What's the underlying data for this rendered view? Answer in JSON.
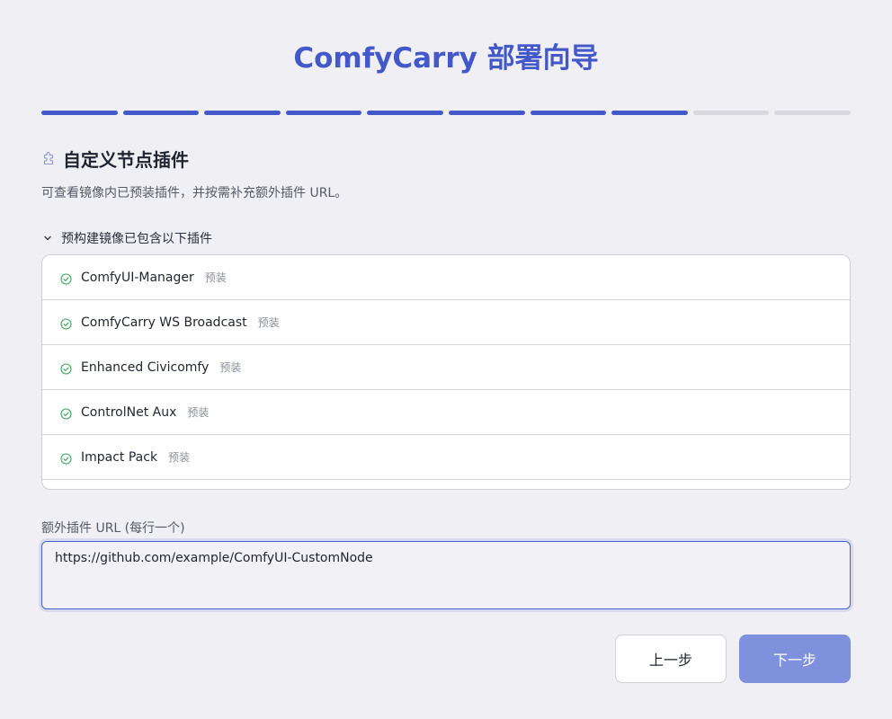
{
  "header": {
    "title": "ComfyCarry 部署向导"
  },
  "progress": {
    "total_steps": 10,
    "completed_steps": 8,
    "accent_color": "#4459c9",
    "inactive_color": "#d8d8de"
  },
  "section": {
    "icon": "puzzle-icon",
    "title": "自定义节点插件",
    "description": "可查看镜像内已预装插件，并按需补充额外插件 URL。"
  },
  "preinstalled": {
    "toggle_label": "预构建镜像已包含以下插件",
    "expanded": true,
    "items": [
      {
        "name": "ComfyUI-Manager",
        "tag": "预装"
      },
      {
        "name": "ComfyCarry WS Broadcast",
        "tag": "预装"
      },
      {
        "name": "Enhanced Civicomfy",
        "tag": "预装"
      },
      {
        "name": "ControlNet Aux",
        "tag": "预装"
      },
      {
        "name": "Impact Pack",
        "tag": "预装"
      }
    ]
  },
  "extra_urls": {
    "label": "额外插件 URL (每行一个)",
    "value": "https://github.com/example/ComfyUI-CustomNode"
  },
  "footer": {
    "prev_label": "上一步",
    "next_label": "下一步"
  }
}
